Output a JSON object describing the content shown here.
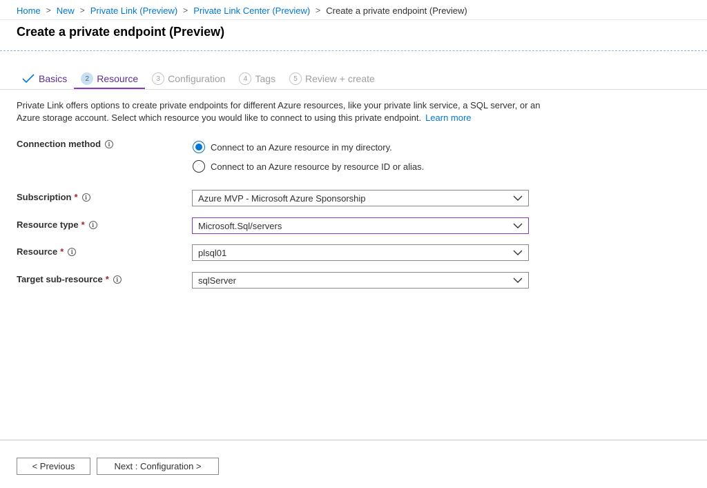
{
  "breadcrumb": {
    "items": [
      "Home",
      "New",
      "Private Link (Preview)",
      "Private Link Center (Preview)"
    ],
    "current": "Create a private endpoint (Preview)",
    "separator": ">"
  },
  "page_title": "Create a private endpoint (Preview)",
  "tabs": [
    {
      "label": "Basics",
      "state": "completed",
      "icon": "checkmark-icon"
    },
    {
      "label": "Resource",
      "step": "2",
      "state": "active"
    },
    {
      "label": "Configuration",
      "step": "3",
      "state": "disabled"
    },
    {
      "label": "Tags",
      "step": "4",
      "state": "disabled"
    },
    {
      "label": "Review + create",
      "step": "5",
      "state": "disabled"
    }
  ],
  "description": {
    "text": "Private Link offers options to create private endpoints for different Azure resources, like your private link service, a SQL server, or an Azure storage account. Select which resource you would like to connect to using this private endpoint.",
    "link": "Learn more"
  },
  "form": {
    "connection_method": {
      "label": "Connection method",
      "options": [
        {
          "label": "Connect to an Azure resource in my directory.",
          "selected": true
        },
        {
          "label": "Connect to an Azure resource by resource ID or alias.",
          "selected": false
        }
      ]
    },
    "subscription": {
      "label": "Subscription",
      "required": "*",
      "value": "Azure MVP - Microsoft Azure Sponsorship"
    },
    "resource_type": {
      "label": "Resource type",
      "required": "*",
      "value": "Microsoft.Sql/servers"
    },
    "resource": {
      "label": "Resource",
      "required": "*",
      "value": "plsql01"
    },
    "target_sub_resource": {
      "label": "Target sub-resource",
      "required": "*",
      "value": "sqlServer"
    }
  },
  "footer": {
    "previous": "< Previous",
    "next": "Next : Configuration >"
  },
  "info_glyph": "i",
  "colors": {
    "link": "#0078d4",
    "accent_purple": "#8a3ab9",
    "required": "#a4262c",
    "radio_selected": "#0078d4"
  }
}
